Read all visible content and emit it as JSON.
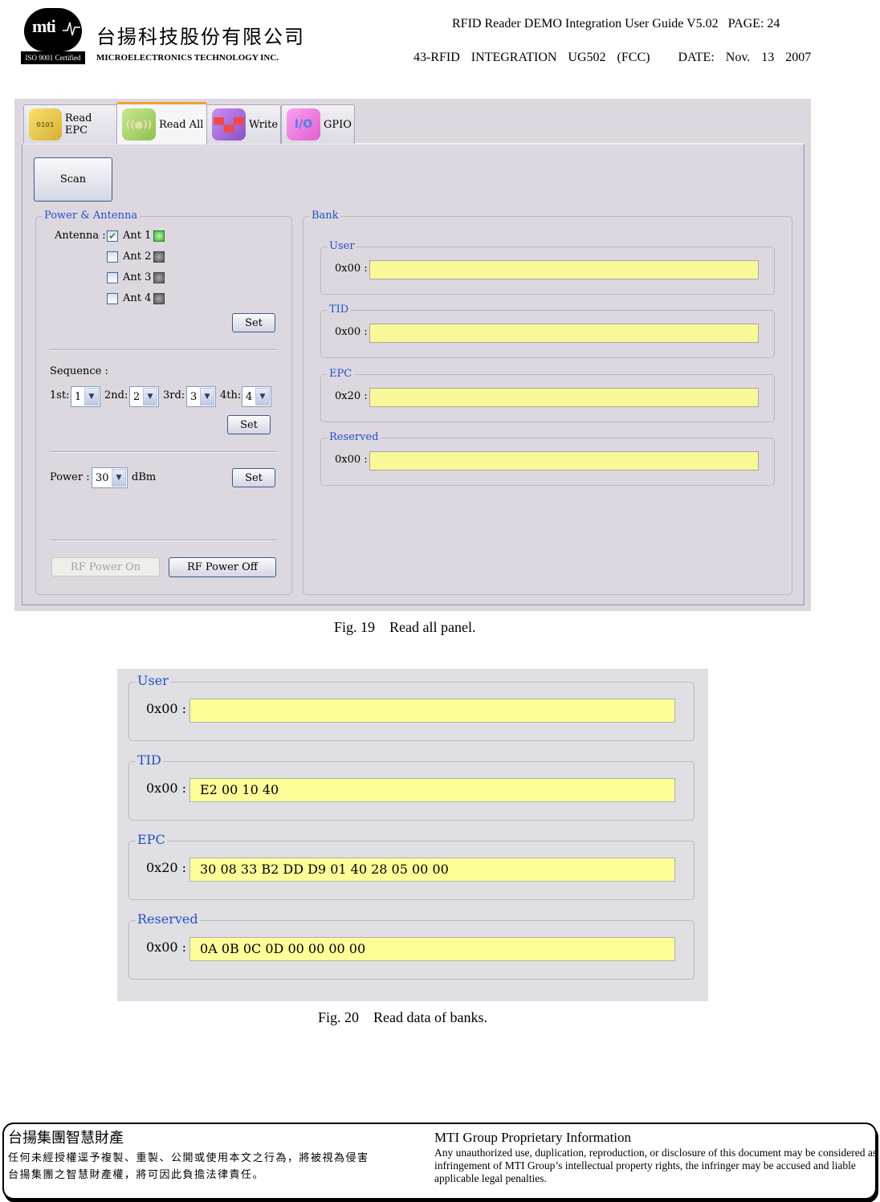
{
  "header": {
    "logo_text": "mti",
    "iso_badge": "ISO 9001 Certified",
    "company_cn": "台揚科技股份有限公司",
    "company_en": "MICROELECTRONICS TECHNOLOGY INC.",
    "doc_title": "RFID Reader DEMO Integration User Guide V5.02",
    "page_label": "PAGE: 24",
    "doc_code": "43-RFID  INTEGRATION  UG502  (FCC)",
    "date_label": "DATE:  Nov.  13  2007"
  },
  "fig19": {
    "tabs": [
      {
        "label": "Read EPC",
        "icon": "binary-card-icon",
        "active": false
      },
      {
        "label": "Read All",
        "icon": "antenna-signal-icon",
        "active": true
      },
      {
        "label": "Write",
        "icon": "write-device-icon",
        "active": false
      },
      {
        "label": "GPIO",
        "icon": "io-icon",
        "active": false
      }
    ],
    "scan_button": "Scan",
    "power_antenna": {
      "title": "Power & Antenna",
      "antenna_label": "Antenna :",
      "antennas": [
        {
          "label": "Ant 1",
          "checked": true,
          "status": "on"
        },
        {
          "label": "Ant 2",
          "checked": false,
          "status": "off"
        },
        {
          "label": "Ant 3",
          "checked": false,
          "status": "off"
        },
        {
          "label": "Ant 4",
          "checked": false,
          "status": "off"
        }
      ],
      "set_label": "Set",
      "sequence_label": "Sequence :",
      "sequence": [
        {
          "label": "1st:",
          "value": "1"
        },
        {
          "label": "2nd:",
          "value": "2"
        },
        {
          "label": "3rd:",
          "value": "3"
        },
        {
          "label": "4th:",
          "value": "4"
        }
      ],
      "power_label": "Power :",
      "power_value": "30",
      "power_unit": "dBm",
      "rf_on": "RF Power On",
      "rf_off": "RF Power Off"
    },
    "bank": {
      "title": "Bank",
      "banks": [
        {
          "name": "User",
          "addr": "0x00 :",
          "value": ""
        },
        {
          "name": "TID",
          "addr": "0x00 :",
          "value": ""
        },
        {
          "name": "EPC",
          "addr": "0x20 :",
          "value": ""
        },
        {
          "name": "Reserved",
          "addr": "0x00 :",
          "value": ""
        }
      ]
    },
    "caption": "Fig. 19    Read all panel."
  },
  "fig20": {
    "banks": [
      {
        "name": "User",
        "addr": "0x00 :",
        "value": ""
      },
      {
        "name": "TID",
        "addr": "0x00 :",
        "value": "E2 00 10 40"
      },
      {
        "name": "EPC",
        "addr": "0x20 :",
        "value": "30 08 33 B2 DD D9 01 40 28 05 00 00"
      },
      {
        "name": "Reserved",
        "addr": "0x00 :",
        "value": "0A 0B 0C 0D 00 00 00 00"
      }
    ],
    "caption": "Fig. 20    Read data of banks."
  },
  "footer": {
    "cn_title": "台揚集團智慧財產",
    "cn_line1": "任何未經授權逕予複製、重製、公開或使用本文之行為，將被視為侵害",
    "cn_line2": "台揚集團之智慧財產權，將可因此負擔法律責任。",
    "en_title": "MTI Group Proprietary Information",
    "en_body": "Any unauthorized use, duplication, reproduction, or disclosure of this document may be considered as infringement of MTI Group’s intellectual property rights, the infringer may be accused and liable applicable legal penalties."
  },
  "colors": {
    "legend_blue": "#2050c8",
    "field_yellow": "#f8f898",
    "active_tab_accent": "#f0a030",
    "led_on": "#40b040"
  }
}
